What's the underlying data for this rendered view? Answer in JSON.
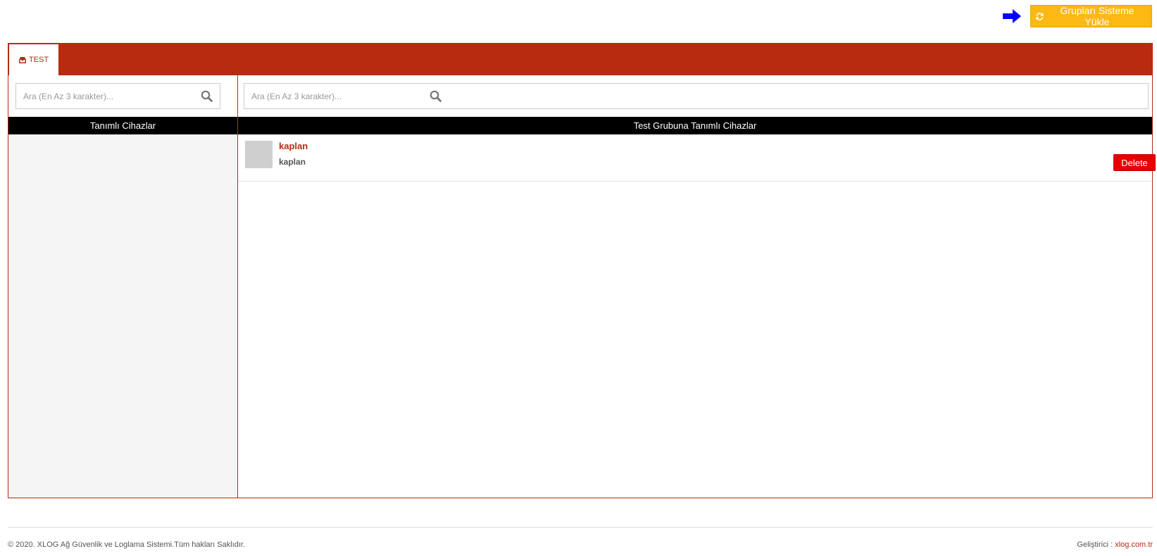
{
  "header": {
    "arrow_icon": "arrow-right-icon",
    "load_button": {
      "label": "Grupları Sisteme Yükle",
      "icon": "refresh-icon"
    }
  },
  "tabs": [
    {
      "label": "TEST",
      "icon": "inbox-icon",
      "active": true
    }
  ],
  "left_panel": {
    "search_placeholder": "Ara (En Az 3 karakter)...",
    "header": "Tanımlı Cihazlar",
    "items": []
  },
  "right_panel": {
    "search_placeholder": "Ara (En Az 3 karakter)...",
    "header": "Test Grubuna Tanımlı Cihazlar",
    "items": [
      {
        "name": "kaplan",
        "subtitle": "kaplan",
        "action_label": "Delete"
      }
    ]
  },
  "footer": {
    "copyright": "© 2020. XLOG Ağ Güvenlik ve Loglama Sistemi.Tüm hakları Saklıdır.",
    "developer_label": "Geliştirici : ",
    "developer_link": "xlog.com.tr"
  },
  "colors": {
    "brand": "#b82b10",
    "button_yellow": "#fcb813",
    "delete_red": "#e60000",
    "arrow_blue": "#0000ff"
  }
}
